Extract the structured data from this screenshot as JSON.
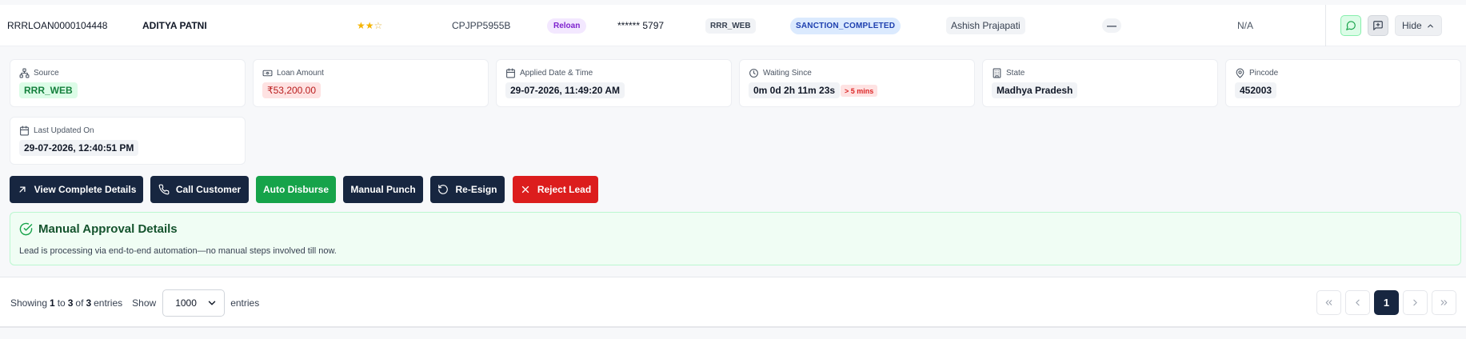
{
  "row": {
    "loan_id": "RRRLOAN0000104448",
    "customer_name": "ADITYA PATNI",
    "stars": [
      "★",
      "★",
      "☆"
    ],
    "pan": "CPJPP5955B",
    "loan_type": "Reloan",
    "phone": "****** 5797",
    "source": "RRR_WEB",
    "status": "SANCTION_COMPLETED",
    "agent": "Ashish Prajapati",
    "placeholder": "—",
    "na": "N/A",
    "hide_label": "Hide"
  },
  "cards": {
    "source": {
      "label": "Source",
      "value": "RRR_WEB"
    },
    "loan_amount": {
      "label": "Loan Amount",
      "value": "₹53,200.00"
    },
    "applied": {
      "label": "Applied Date & Time",
      "value": "29-07-2026, 11:49:20 AM"
    },
    "waiting": {
      "label": "Waiting Since",
      "value": "0m 0d 2h 11m 23s",
      "tag": "> 5 mins"
    },
    "state": {
      "label": "State",
      "value": "Madhya Pradesh"
    },
    "pincode": {
      "label": "Pincode",
      "value": "452003"
    },
    "last_updated": {
      "label": "Last Updated On",
      "value": "29-07-2026, 12:40:51 PM"
    }
  },
  "buttons": {
    "view_details": "View Complete Details",
    "call_customer": "Call Customer",
    "auto_disburse": "Auto Disburse",
    "manual_punch": "Manual Punch",
    "re_esign": "Re-Esign",
    "reject_lead": "Reject Lead"
  },
  "approval": {
    "title": "Manual Approval Details",
    "description": "Lead is processing via end-to-end automation—no manual steps involved till now."
  },
  "footer": {
    "showing": "Showing",
    "from": "1",
    "to_word": "to",
    "to": "3",
    "of_word": "of",
    "total": "3",
    "entries_word": "entries",
    "show_label": "Show",
    "page_size": "1000",
    "entries_label": "entries",
    "current_page": "1"
  },
  "colors": {
    "navy": "#172640",
    "green": "#16a34a",
    "red": "#dc1d1d",
    "star": "#f5b400"
  },
  "icons": [
    "whatsapp-icon",
    "chat-icon",
    "chevron-up-icon",
    "source-icon",
    "cash-icon",
    "calendar-icon",
    "clock-icon",
    "building-icon",
    "map-pin-icon",
    "external-link-icon",
    "phone-icon",
    "refresh-icon",
    "x-icon",
    "check-circle-icon",
    "chevron-down-icon",
    "chevrons-left-icon",
    "chevron-left-icon",
    "chevron-right-icon",
    "chevrons-right-icon"
  ]
}
